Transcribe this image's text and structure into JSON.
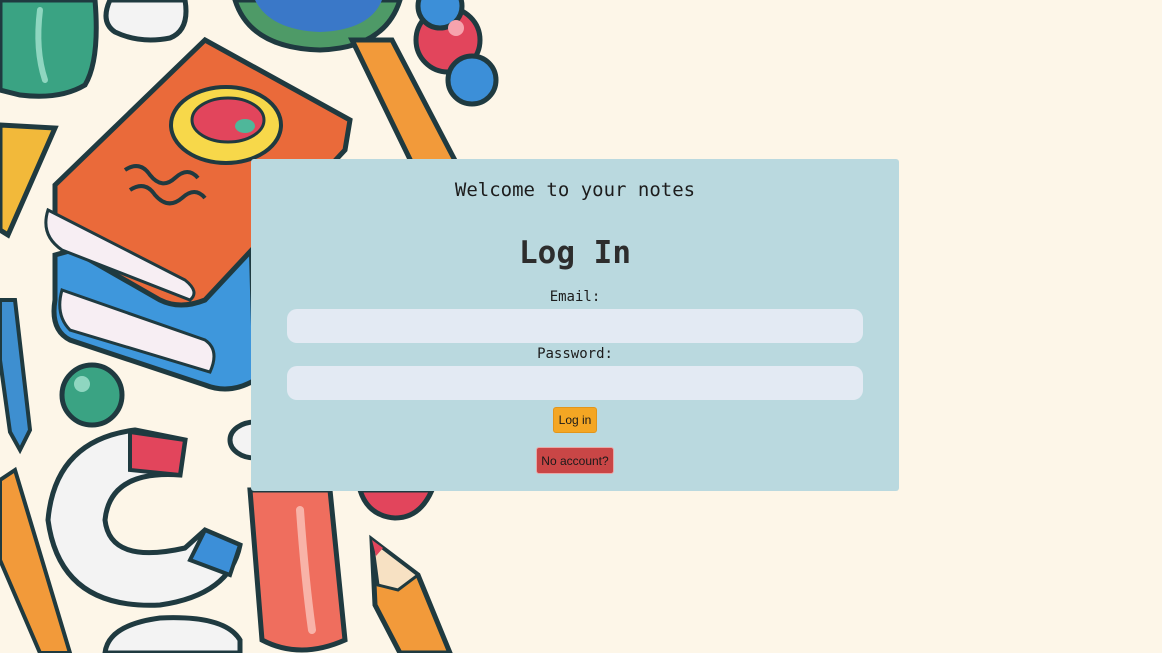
{
  "page": {
    "welcome_text": "Welcome to your notes",
    "heading": "Log In"
  },
  "form": {
    "email_label": "Email:",
    "email_value": "",
    "password_label": "Password:",
    "password_value": "",
    "login_button": "Log in",
    "register_button": "No account?"
  },
  "colors": {
    "page_background": "#fdf6e8",
    "card_background": "#bad9df",
    "input_background": "#e3eaf3",
    "login_button": "#f4a623",
    "register_button": "#c94646"
  }
}
